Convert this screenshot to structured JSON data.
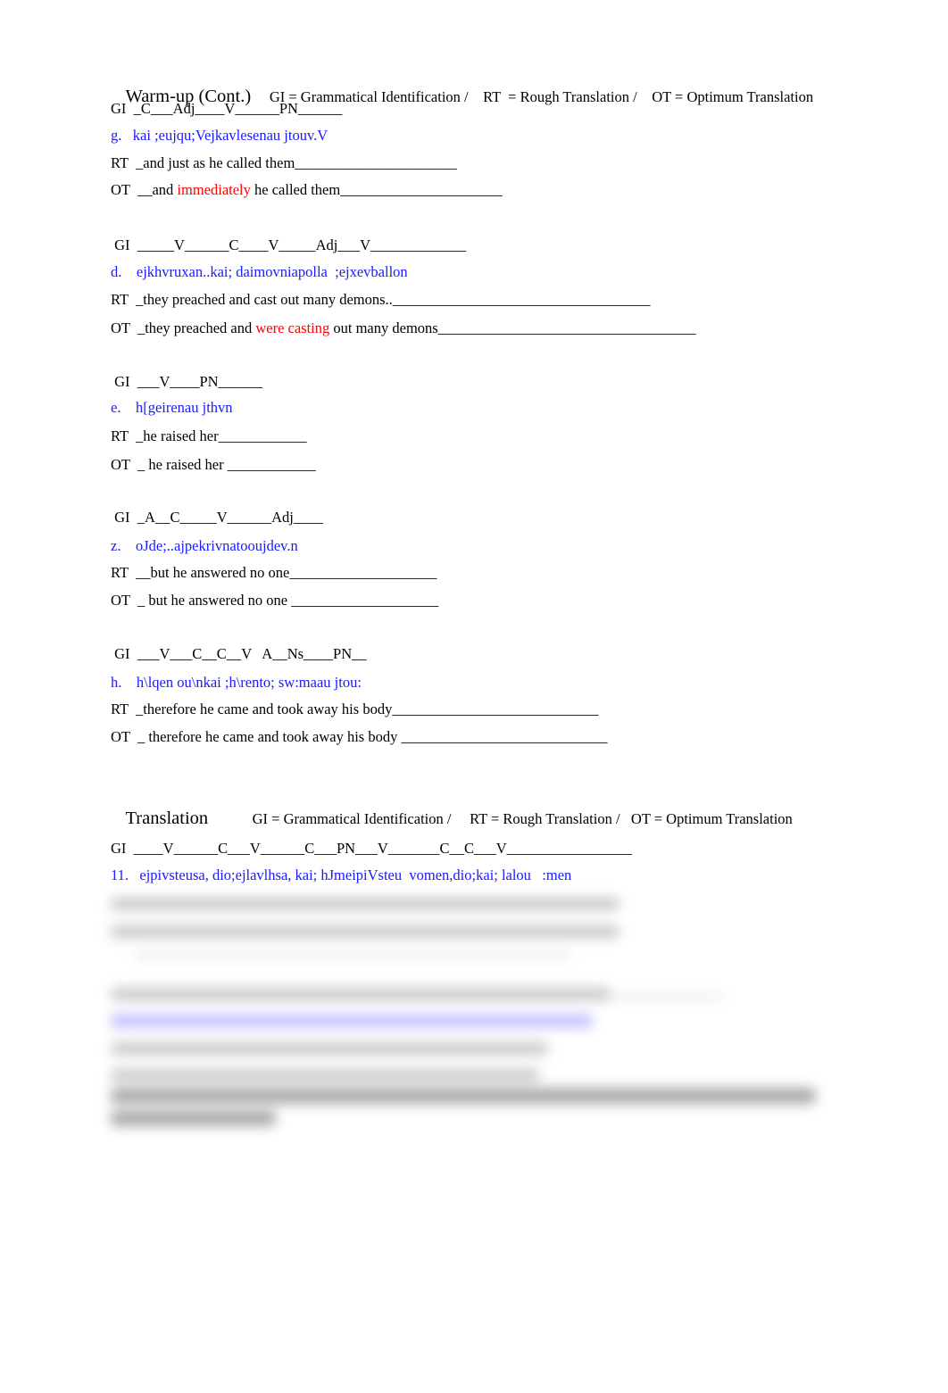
{
  "warmup": {
    "heading": "Warm-up (Cont.)",
    "legend": "     GI = Grammatical Identification /    RT  = Rough Translation /    OT = Optimum Translation",
    "exercises": [
      {
        "gi": "GI  _C___Adj____V______PN______",
        "greek": "g.   kai ;eujqu;Vejkavlesenau jtouv.V",
        "rt": "RT  _and just as he called them______________________",
        "ot_pre": "OT  __and ",
        "ot_red": "immediately",
        "ot_post": " he called them______________________"
      },
      {
        "gi": " GI  _____V______C____V_____Adj___V_____________",
        "greek": "d.    ejkhvruxan..kai; daimovniapolla  ;ejxevballon",
        "rt": "RT  _they preached and cast out many demons..___________________________________",
        "ot_pre": "OT  _they preached and ",
        "ot_red": "were casting",
        "ot_post": " out many demons___________________________________"
      },
      {
        "gi": " GI  ___V____PN______",
        "greek": "e.    h[geirenau jthvn",
        "rt": "RT  _he raised her____________",
        "ot_pre": "OT  _ he raised her ____________",
        "ot_red": "",
        "ot_post": ""
      },
      {
        "gi": " GI  _A__C_____V______Adj____",
        "greek": "z.    oJde;..ajpekrivnatooujdev.n",
        "rt": "RT  __but he answered no one____________________",
        "ot_pre": "OT  _ but he answered no one ____________________",
        "ot_red": "",
        "ot_post": ""
      },
      {
        "gi": " GI  ___V___C__C__V   A__Ns____PN__",
        "greek": "h.    h\\lqen ou\\nkai ;h\\rento; sw:maau jtou:",
        "rt": "RT  _therefore he came and took away his body____________________________",
        "ot_pre": "OT  _ therefore he came and took away his body ____________________________",
        "ot_red": "",
        "ot_post": ""
      }
    ]
  },
  "translation": {
    "heading": "Translation",
    "legend": "            GI = Grammatical Identification /     RT = Rough Translation /   OT = Optimum Translation",
    "item": {
      "gi": "GI  ____V______C___V______C___PN___V_______C__C___V_________________",
      "greek": "11.   ejpivsteusa, dio;ejlavlhsa, kai; hJmeipiVsteu  vomen,dio;kai; lalou   :men"
    }
  }
}
